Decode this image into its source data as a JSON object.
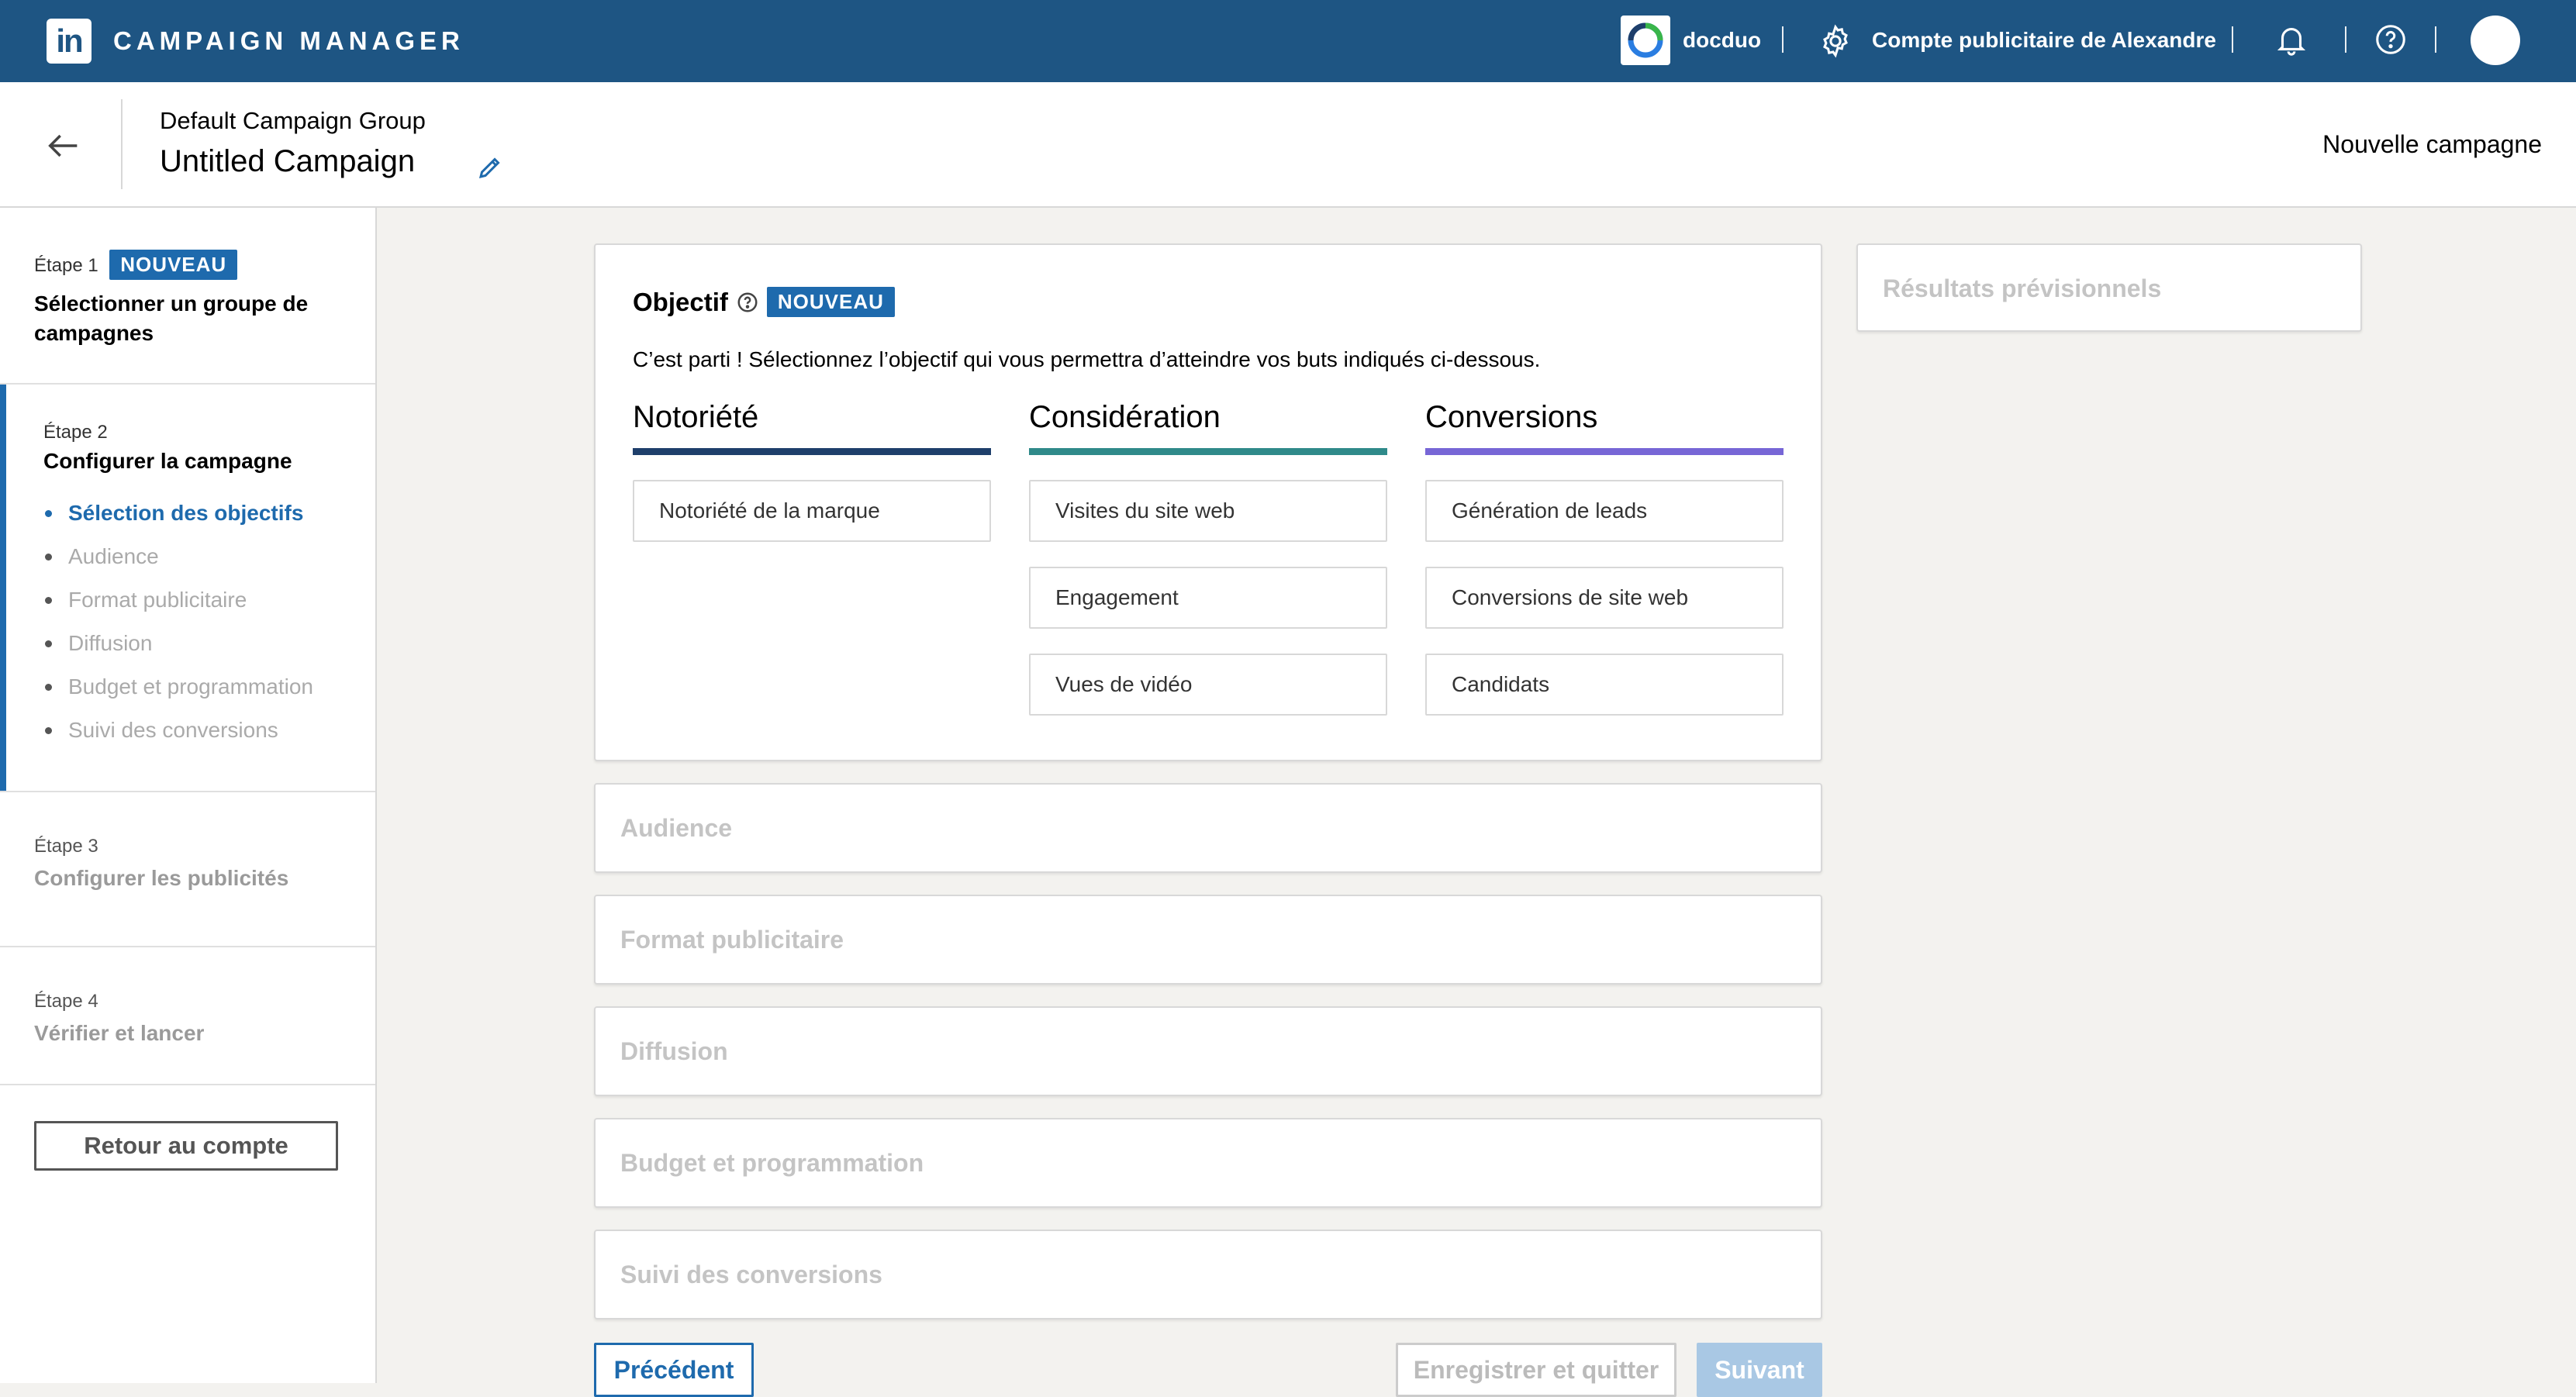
{
  "topbar": {
    "logo_text": "in",
    "brand": "CAMPAIGN MANAGER",
    "org_name": "docduo",
    "account_name": "Compte publicitaire de Alexandre"
  },
  "header": {
    "group_name": "Default Campaign Group",
    "campaign_name": "Untitled Campaign",
    "new_campaign": "Nouvelle campagne"
  },
  "sidebar": {
    "step1": {
      "num": "Étape 1",
      "badge": "NOUVEAU",
      "title": "Sélectionner un groupe de campagnes"
    },
    "step2": {
      "num": "Étape 2",
      "title": "Configurer la campagne",
      "substeps": [
        "Sélection des objectifs",
        "Audience",
        "Format publicitaire",
        "Diffusion",
        "Budget et programmation",
        "Suivi des conversions"
      ]
    },
    "step3": {
      "num": "Étape 3",
      "title": "Configurer les publicités"
    },
    "step4": {
      "num": "Étape 4",
      "title": "Vérifier et lancer"
    },
    "back_button": "Retour au compte"
  },
  "objective": {
    "title": "Objectif",
    "badge": "NOUVEAU",
    "description": "C’est parti ! Sélectionnez l’objectif qui vous permettra d’atteindre vos buts indiqués ci-dessous.",
    "columns": [
      {
        "title": "Notoriété",
        "color": "#1e3f6b",
        "options": [
          "Notoriété de la marque"
        ]
      },
      {
        "title": "Considération",
        "color": "#2f8a8a",
        "options": [
          "Visites du site web",
          "Engagement",
          "Vues de vidéo"
        ]
      },
      {
        "title": "Conversions",
        "color": "#7766d6",
        "options": [
          "Génération de leads",
          "Conversions de site web",
          "Candidats"
        ]
      }
    ]
  },
  "sections": {
    "audience": "Audience",
    "format": "Format publicitaire",
    "diffusion": "Diffusion",
    "budget": "Budget et programmation",
    "suivi": "Suivi des conversions"
  },
  "forecast": {
    "title": "Résultats prévisionnels"
  },
  "footer": {
    "previous": "Précédent",
    "save_quit": "Enregistrer et quitter",
    "next": "Suivant"
  },
  "colors": {
    "topbar": "#1e5583",
    "accent": "#1e6aad"
  }
}
